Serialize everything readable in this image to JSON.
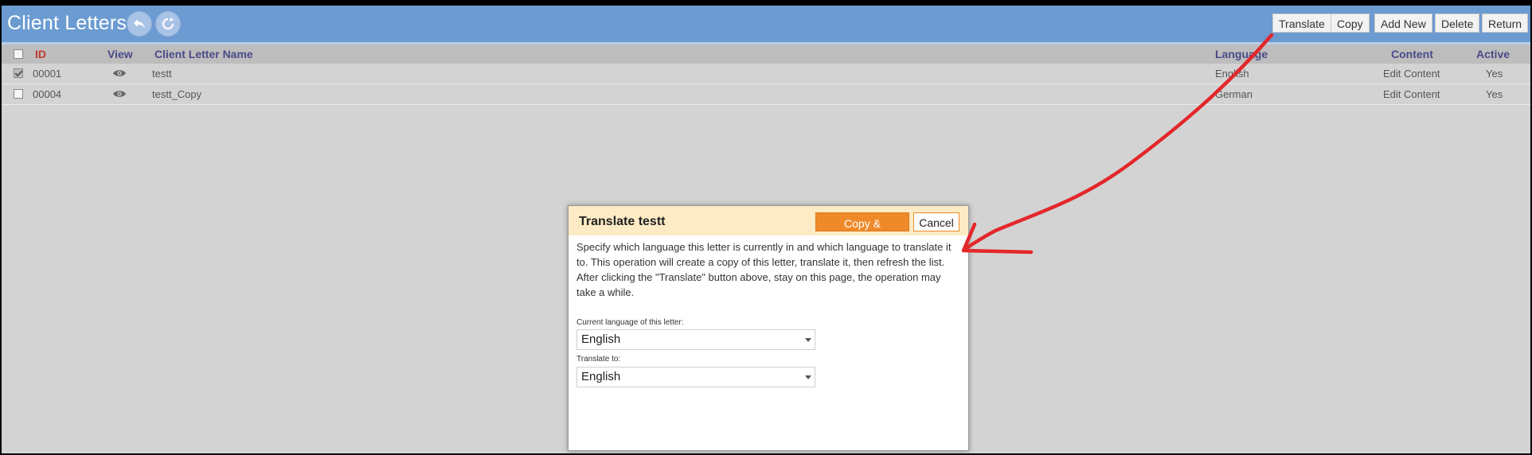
{
  "header": {
    "title": "Client Letters",
    "icons": [
      "undo-icon",
      "refresh-icon"
    ],
    "buttons": {
      "translate": "Translate",
      "copy": "Copy",
      "add_new": "Add New",
      "delete": "Delete",
      "return": "Return"
    }
  },
  "table": {
    "columns": {
      "id": "ID",
      "view": "View",
      "name": "Client Letter Name",
      "language": "Language",
      "content": "Content",
      "active": "Active"
    },
    "rows": [
      {
        "checked": true,
        "id": "00001",
        "name": "testt",
        "language": "English",
        "content": "Edit Content",
        "active": "Yes"
      },
      {
        "checked": false,
        "id": "00004",
        "name": "testt_Copy",
        "language": "German",
        "content": "Edit Content",
        "active": "Yes"
      }
    ]
  },
  "dialog": {
    "title": "Translate testt",
    "primary_button": "Copy & Translate",
    "cancel_button": "Cancel",
    "description_1": "Specify which language this letter is currently in and which language to translate it to. This operation will create a copy of this letter, translate it, then refresh the list.",
    "description_2": "After clicking the \"Translate\" button above, stay on this page, the operation may take a while.",
    "current_language_label": "Current language of this letter:",
    "current_language_value": "English",
    "translate_to_label": "Translate to:",
    "translate_to_value": "English"
  },
  "colors": {
    "header_bg": "#6b9bd1",
    "dialog_header_bg": "#fcebc4",
    "primary_button": "#ef8a2a",
    "annotation_arrow": "#e3272a"
  }
}
